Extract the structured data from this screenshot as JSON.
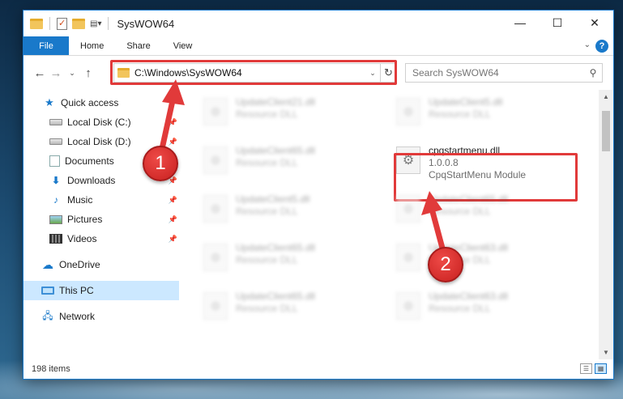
{
  "window": {
    "title": "SysWOW64",
    "caption": {
      "minimize": "—",
      "maximize": "☐",
      "close": "✕"
    }
  },
  "ribbon": {
    "tabs": [
      "File",
      "Home",
      "Share",
      "View"
    ],
    "expand_glyph": "⌄",
    "help_glyph": "?"
  },
  "address": {
    "back_glyph": "←",
    "forward_glyph": "→",
    "recent_glyph": "⌄",
    "up_glyph": "↑",
    "path": "C:\\Windows\\SysWOW64",
    "dropdown_glyph": "⌄",
    "refresh_glyph": "↻"
  },
  "search": {
    "placeholder": "Search SysWOW64",
    "icon_glyph": "⚲"
  },
  "sidebar": {
    "items": [
      {
        "label": "Quick access",
        "icon": "star-icon",
        "glyph": "★",
        "pinned": false
      },
      {
        "label": "Local Disk (C:)",
        "icon": "drive-icon",
        "glyph": "",
        "pinned": true
      },
      {
        "label": "Local Disk (D:)",
        "icon": "drive-icon",
        "glyph": "",
        "pinned": true
      },
      {
        "label": "Documents",
        "icon": "document-icon",
        "glyph": "",
        "pinned": true
      },
      {
        "label": "Downloads",
        "icon": "download-icon",
        "glyph": "⬇",
        "pinned": true
      },
      {
        "label": "Music",
        "icon": "music-icon",
        "glyph": "♪",
        "pinned": true
      },
      {
        "label": "Pictures",
        "icon": "picture-icon",
        "glyph": "",
        "pinned": true
      },
      {
        "label": "Videos",
        "icon": "video-icon",
        "glyph": "",
        "pinned": true
      },
      {
        "label": "OneDrive",
        "icon": "cloud-icon",
        "glyph": "☁",
        "pinned": false
      },
      {
        "label": "This PC",
        "icon": "computer-icon",
        "glyph": "",
        "pinned": false
      },
      {
        "label": "Network",
        "icon": "network-icon",
        "glyph": "🖧",
        "pinned": false
      }
    ],
    "pin_glyph": "📌"
  },
  "files": [
    {
      "name": "UpdateClient21.dll",
      "desc": "Resource DLL"
    },
    {
      "name": "UpdateClient5.dll",
      "desc": "Resource DLL"
    },
    {
      "name": "UpdateClient65.dll",
      "desc": "Resource DLL"
    },
    {
      "name": "cpqstartmenu.dll",
      "version": "1.0.0.8",
      "desc": "CpqStartMenu Module"
    },
    {
      "name": "UpdateClient5.dll",
      "desc": "Resource DLL"
    },
    {
      "name": "UpdateClient65.dll",
      "desc": "Resource DLL"
    },
    {
      "name": "UpdateClient65.dll",
      "desc": "Resource DLL"
    },
    {
      "name": "UpdateClient63.dll",
      "desc": "Resource DLL"
    },
    {
      "name": "UpdateClient65.dll",
      "desc": "Resource DLL"
    },
    {
      "name": "UpdateClient63.dll",
      "desc": "Resource DLL"
    }
  ],
  "gear_glyph": "⚙",
  "status": {
    "items": "198 items"
  },
  "annotations": {
    "step1": "1",
    "step2": "2",
    "color": "#e13a3a"
  },
  "scroll": {
    "up_glyph": "▲",
    "down_glyph": "▼"
  },
  "view": {
    "details_glyph": "☰",
    "tiles_glyph": "▦"
  }
}
